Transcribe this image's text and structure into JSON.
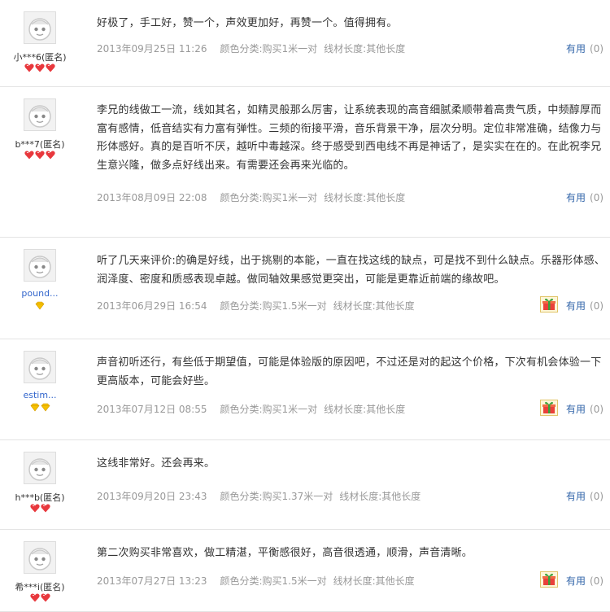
{
  "reviews": [
    {
      "user": "小***6(匿名)",
      "user_style": "plain",
      "rank": "hearts",
      "rank_count": 3,
      "content": "好极了，手工好，赞一个，声效更加好，再赞一个。值得拥有。",
      "date": "2013年09月25日 11:26",
      "color_class": "颜色分类:购买1米一对",
      "length": "线材长度:其他长度",
      "has_gift": false,
      "useful_label": "有用",
      "useful_count": "(0)"
    },
    {
      "user": "b***7(匿名)",
      "user_style": "plain",
      "rank": "hearts",
      "rank_count": 3,
      "content": "李兄的线做工一流，线如其名，如精灵般那么厉害，让系统表现的高音细腻柔顺带着高贵气质，中频醇厚而富有感情，低音结实有力富有弹性。三频的衔接平滑，音乐背景干净，层次分明。定位非常准确，结像力与形体感好。真的是百听不厌，越听中毒越深。终于感受到西电线不再是神话了，是实实在在的。在此祝李兄生意兴隆，做多点好线出来。有需要还会再来光临的。",
      "date": "2013年08月09日 22:08",
      "color_class": "颜色分类:购买1米一对",
      "length": "线材长度:其他长度",
      "has_gift": false,
      "useful_label": "有用",
      "useful_count": "(0)"
    },
    {
      "user": "pound...",
      "user_style": "link",
      "rank": "diamonds",
      "rank_count": 1,
      "content": "听了几天来评价:的确是好线，出于挑剔的本能，一直在找这线的缺点，可是找不到什么缺点。乐器形体感、润泽度、密度和质感表现卓越。做同轴效果感觉更突出，可能是更靠近前端的缘故吧。",
      "date": "2013年06月29日 16:54",
      "color_class": "颜色分类:购买1.5米一对",
      "length": "线材长度:其他长度",
      "has_gift": true,
      "useful_label": "有用",
      "useful_count": "(0)"
    },
    {
      "user": "estim...",
      "user_style": "link",
      "rank": "diamonds",
      "rank_count": 2,
      "content": "声音初听还行，有些低于期望值，可能是体验版的原因吧，不过还是对的起这个价格，下次有机会体验一下更高版本，可能会好些。",
      "date": "2013年07月12日 08:55",
      "color_class": "颜色分类:购买1米一对",
      "length": "线材长度:其他长度",
      "has_gift": true,
      "useful_label": "有用",
      "useful_count": "(0)"
    },
    {
      "user": "h***b(匿名)",
      "user_style": "plain",
      "rank": "hearts",
      "rank_count": 2,
      "content": "这线非常好。还会再来。",
      "date": "2013年09月20日 23:43",
      "color_class": "颜色分类:购买1.37米一对",
      "length": "线材长度:其他长度",
      "has_gift": false,
      "useful_label": "有用",
      "useful_count": "(0)"
    },
    {
      "user": "希***i(匿名)",
      "user_style": "plain",
      "rank": "hearts",
      "rank_count": 2,
      "content": "第二次购买非常喜欢，做工精湛，平衡感很好，高音很透通，顺滑，声音清晰。",
      "date": "2013年07月27日 13:23",
      "color_class": "颜色分类:购买1.5米一对",
      "length": "线材长度:其他长度",
      "has_gift": true,
      "useful_label": "有用",
      "useful_count": "(0)"
    }
  ],
  "colors": {
    "heart": "#e8383d",
    "diamond": "#f2b300",
    "link": "#3366cc",
    "meta": "#999999"
  },
  "icons": {
    "avatar": "default-avatar-icon",
    "heart": "heart-rank-icon",
    "diamond": "diamond-rank-icon",
    "gift": "gift-icon"
  }
}
